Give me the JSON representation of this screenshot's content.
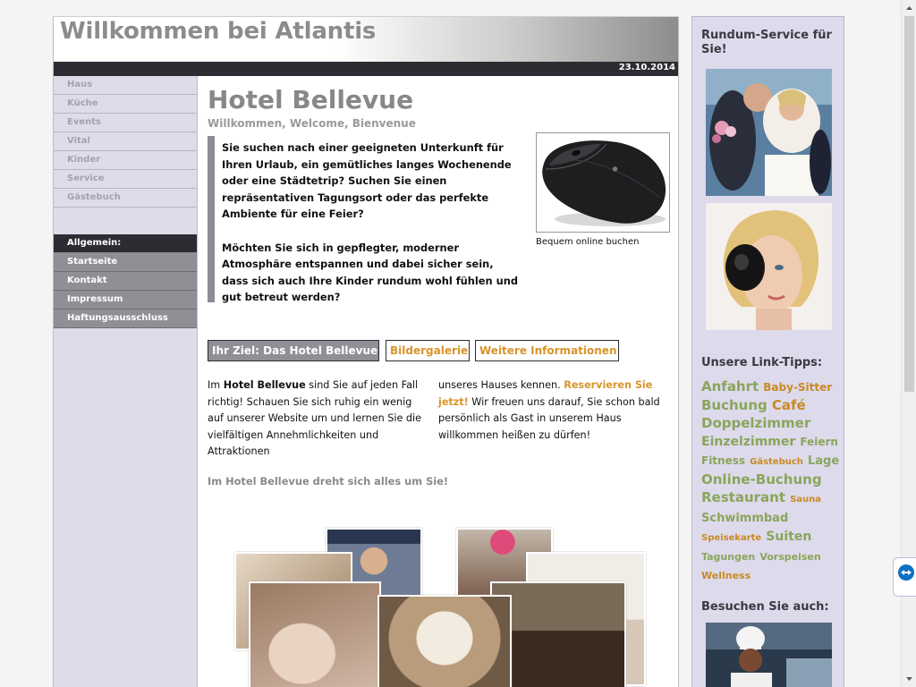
{
  "header": {
    "site_title": "Willkommen bei Atlantis",
    "date": "23.10.2014"
  },
  "leftnav": {
    "items": [
      "Haus",
      "Küche",
      "Events",
      "Vital",
      "Kinder",
      "Service",
      "Gästebuch"
    ],
    "section_heading": "Allgemein:",
    "section_items": [
      "Startseite",
      "Kontakt",
      "Impressum",
      "Haftungsausschluss"
    ]
  },
  "content": {
    "title": "Hotel Bellevue",
    "subtitle": "Willkommen, Welcome, Bienvenue",
    "intro_p1": "Sie suchen nach einer geeigneten Unterkunft für Ihren Urlaub, ein gemütliches langes Wochenende oder eine Städtetrip? Suchen Sie einen repräsentativen Tagungsort oder das perfekte Ambiente für eine Feier?",
    "intro_p2": "Möchten Sie sich in gepflegter, moderner Atmosphäre entspannen und dabei sicher sein, dass sich auch Ihre Kinder rundum wohl fühlen und gut betreut werden?",
    "image_caption": "Bequem online buchen",
    "tabs": [
      "Ihr Ziel: Das Hotel Bellevue",
      "Bildergalerie",
      "Weitere Informationen"
    ],
    "col1_pre": "Im ",
    "col1_bold": "Hotel Bellevue",
    "col1_post": " sind Sie auf jeden Fall richtig! Schauen Sie sich ruhig ein wenig auf unserer Website um und lernen Sie die vielfältigen Annehmlichkeiten und Attraktionen",
    "col2_pre": "unseres Hauses kennen. ",
    "col2_link": "Reservieren Sie jetzt!",
    "col2_post": " Wir freuen uns darauf, Sie schon bald persönlich als Gast in unserem Haus willkommen heißen zu dürfen!",
    "tagline": "Im Hotel Bellevue dreht sich alles um Sie!"
  },
  "right": {
    "service_heading": "Rundum-Service für Sie!",
    "link_heading": "Unsere Link-Tipps:",
    "visit_heading": "Besuchen Sie auch:",
    "tags": [
      {
        "text": "Anfahrt",
        "size": "15px",
        "color": "green"
      },
      {
        "text": "Baby-Sitter",
        "size": "12px",
        "color": "orange"
      },
      {
        "text": "Buchung",
        "size": "15px",
        "color": "green"
      },
      {
        "text": "Café",
        "size": "15px",
        "color": "orange"
      },
      {
        "text": "Doppelzimmer",
        "size": "15px",
        "color": "green"
      },
      {
        "text": "Einzelzimmer",
        "size": "14px",
        "color": "green"
      },
      {
        "text": "Feiern",
        "size": "12px",
        "color": "green"
      },
      {
        "text": "Fitness",
        "size": "12px",
        "color": "green"
      },
      {
        "text": "Gästebuch",
        "size": "10px",
        "color": "orange"
      },
      {
        "text": "Lage",
        "size": "13px",
        "color": "green"
      },
      {
        "text": "Online-Buchung",
        "size": "15px",
        "color": "green"
      },
      {
        "text": "Restaurant",
        "size": "15px",
        "color": "green"
      },
      {
        "text": "Sauna",
        "size": "10px",
        "color": "orange"
      },
      {
        "text": "Schwimmbad",
        "size": "13px",
        "color": "green"
      },
      {
        "text": "Speisekarte",
        "size": "10px",
        "color": "orange"
      },
      {
        "text": "Suiten",
        "size": "14px",
        "color": "green"
      },
      {
        "text": "Tagungen",
        "size": "11px",
        "color": "green"
      },
      {
        "text": "Vorspeisen",
        "size": "11px",
        "color": "green"
      },
      {
        "text": "Wellness",
        "size": "11px",
        "color": "orange"
      }
    ]
  },
  "colors": {
    "accent_orange": "#d9942a",
    "tag_green": "#8aa55a",
    "dark_bar": "#2c2c33",
    "nav_bg": "#dfdcea"
  }
}
